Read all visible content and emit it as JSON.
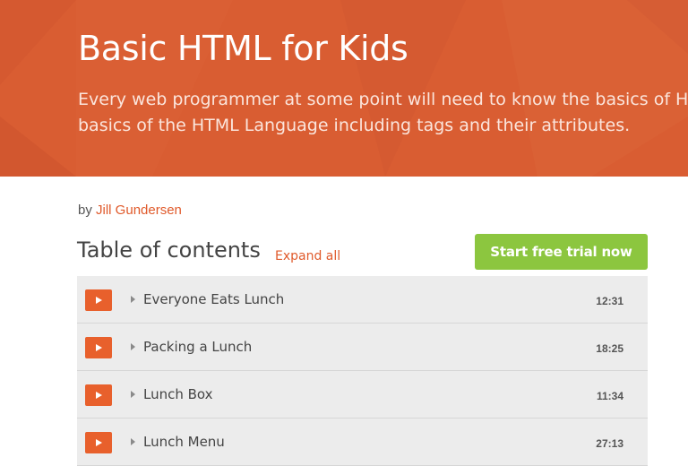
{
  "hero": {
    "title": "Basic HTML for Kids",
    "description_lines": [
      "Every web programmer at some point will need to know the basics of HTM",
      "basics of the HTML Language including tags and their attributes."
    ],
    "background_color": "#d95d32"
  },
  "byline": {
    "prefix": "by",
    "author": "Jill Gundersen"
  },
  "toc": {
    "title": "Table of contents",
    "expand_label": "Expand all",
    "cta_label": "Start free trial now",
    "items": [
      {
        "title": "Everyone Eats Lunch",
        "duration": "12:31"
      },
      {
        "title": "Packing a Lunch",
        "duration": "18:25"
      },
      {
        "title": "Lunch Box",
        "duration": "11:34"
      },
      {
        "title": "Lunch Menu",
        "duration": "27:13"
      }
    ]
  },
  "colors": {
    "accent": "#e05a2b",
    "cta": "#8cc63f",
    "play_button": "#e8602c"
  }
}
